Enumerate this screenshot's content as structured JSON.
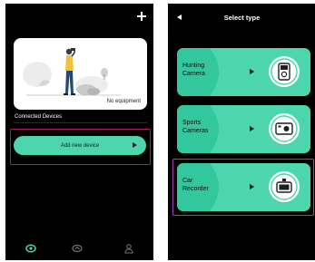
{
  "home": {
    "empty_state_text": "No equipment",
    "section_label": "Connected Devices",
    "add_device_label": "Add new device"
  },
  "select_type": {
    "title": "Select type",
    "types": [
      {
        "line1": "Hunting",
        "line2": "Camera",
        "icon": "trail-camera-icon"
      },
      {
        "line1": "Sports",
        "line2": "Cameras",
        "icon": "action-camera-icon"
      },
      {
        "line1": "Car",
        "line2": "Recorder",
        "icon": "dashcam-icon"
      }
    ]
  },
  "colors": {
    "accent": "#4dd6ad",
    "accent_dark": "#2cc399",
    "background": "#000000",
    "highlight_left": "#b01a5a",
    "highlight_right": "#9b3fb1"
  }
}
